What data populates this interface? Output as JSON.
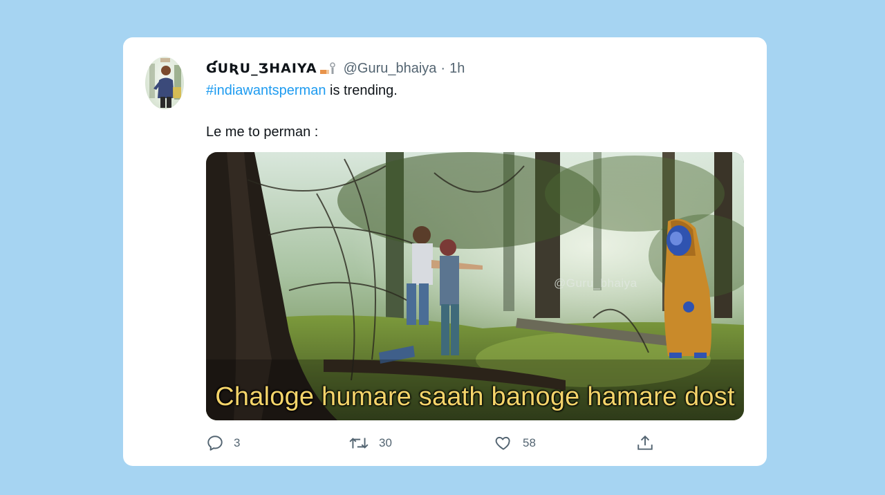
{
  "tweet": {
    "display_name": "ƓUƦU_ƷHAIYA",
    "handle": "@Guru_bhaiya",
    "separator": "·",
    "time": "1h",
    "hashtag": "#indiawantsperman",
    "text_after_hashtag": " is trending.",
    "line2": "Le me to perman :",
    "media": {
      "watermark": "@Guru_bhaiya",
      "subtitle": "Chaloge humare saath banoge hamare dost"
    }
  },
  "actions": {
    "reply_icon": "reply-icon",
    "reply_count": "3",
    "retweet_icon": "retweet-icon",
    "retweet_count": "30",
    "like_icon": "heart-icon",
    "like_count": "58",
    "share_icon": "share-icon"
  },
  "colors": {
    "background": "#a6d4f2",
    "card": "#ffffff",
    "hashtag": "#1d9bf0",
    "secondary_text": "#536471",
    "subtitle": "#f4d46a"
  }
}
